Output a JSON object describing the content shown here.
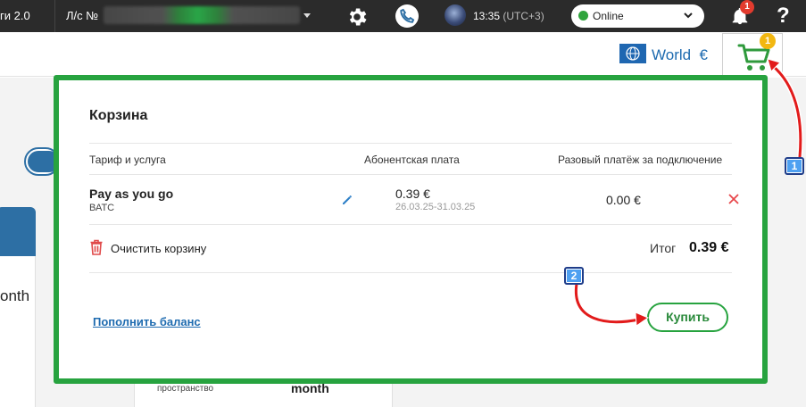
{
  "topbar": {
    "brand_fragment": "ги 2.0",
    "account_label": "Л/с №",
    "time": "13:35",
    "timezone": "(UTC+3)",
    "status": "Online",
    "status_color": "#2fa43c",
    "notifications_count": "1",
    "help_label": "?"
  },
  "header": {
    "region_label": "World",
    "currency": "€",
    "cart_count": "1"
  },
  "background": {
    "month_left": "onth",
    "space_label": "пространство",
    "month_bottom": "month"
  },
  "cart": {
    "title": "Корзина",
    "columns": [
      "Тариф и услуга",
      "Абонентская плата",
      "Разовый платёж за подключение"
    ],
    "items": [
      {
        "name": "Pay as you go",
        "subtitle": "ВАТС",
        "fee": "0.39 €",
        "period": "26.03.25-31.03.25",
        "connection_fee": "0.00 €"
      }
    ],
    "clear_label": "Очистить корзину",
    "total_label": "Итог",
    "total_value": "0.39 €",
    "topup_link": "Пополнить баланс",
    "buy_label": "Купить",
    "accent_color": "#27a33f"
  },
  "annotations": {
    "step1": "1",
    "step2": "2"
  }
}
